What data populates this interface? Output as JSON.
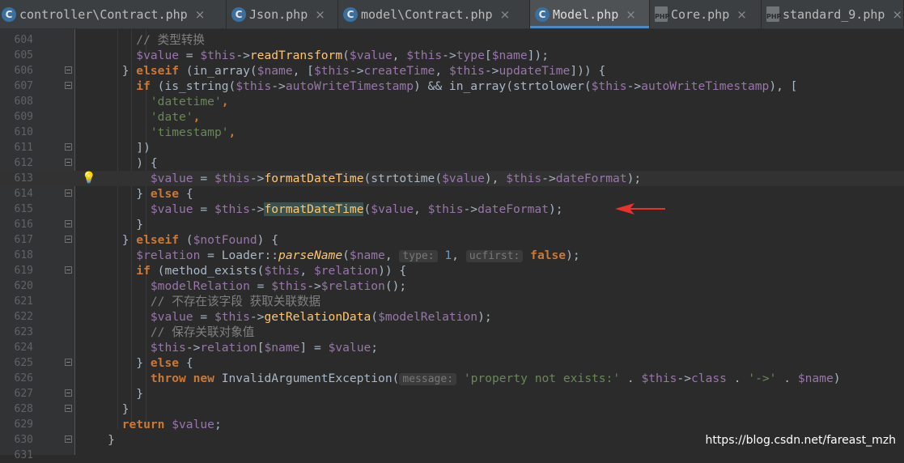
{
  "tabs": [
    {
      "label": "controller\\Contract.php",
      "icon": "C",
      "icon_type": "php-class-icon",
      "close": "×",
      "active": false
    },
    {
      "label": "Json.php",
      "icon": "C",
      "icon_type": "php-class-icon",
      "close": "×",
      "active": false
    },
    {
      "label": "model\\Contract.php",
      "icon": "C",
      "icon_type": "php-class-icon",
      "close": "×",
      "active": false
    },
    {
      "label": "Model.php",
      "icon": "C",
      "icon_type": "php-class-icon",
      "close": "×",
      "active": true
    },
    {
      "label": "Core.php",
      "icon": "PHP",
      "icon_type": "php-file-icon",
      "close": "×",
      "active": false
    },
    {
      "label": "standard_9.php",
      "icon": "PHP",
      "icon_type": "php-file-icon",
      "close": "×",
      "active": false
    }
  ],
  "lines": [
    {
      "num": "604",
      "fold": false,
      "indent": 8,
      "segs": [
        {
          "t": "// 类型转换",
          "c": "cmt"
        }
      ]
    },
    {
      "num": "605",
      "fold": false,
      "indent": 8,
      "segs": [
        {
          "t": "$value",
          "c": "var"
        },
        {
          "t": " = ",
          "c": "pl"
        },
        {
          "t": "$this",
          "c": "var"
        },
        {
          "t": "->",
          "c": "pl"
        },
        {
          "t": "readTransform",
          "c": "fn"
        },
        {
          "t": "(",
          "c": "pl"
        },
        {
          "t": "$value",
          "c": "var"
        },
        {
          "t": ", ",
          "c": "pl"
        },
        {
          "t": "$this",
          "c": "var"
        },
        {
          "t": "->",
          "c": "pl"
        },
        {
          "t": "type",
          "c": "var"
        },
        {
          "t": "[",
          "c": "pl"
        },
        {
          "t": "$name",
          "c": "var"
        },
        {
          "t": "]);",
          "c": "pl"
        }
      ]
    },
    {
      "num": "606",
      "fold": true,
      "indent": 6,
      "segs": [
        {
          "t": "} ",
          "c": "pl"
        },
        {
          "t": "elseif",
          "c": "kw"
        },
        {
          "t": " (in_array(",
          "c": "pl"
        },
        {
          "t": "$name",
          "c": "var"
        },
        {
          "t": ", [",
          "c": "pl"
        },
        {
          "t": "$this",
          "c": "var"
        },
        {
          "t": "->",
          "c": "pl"
        },
        {
          "t": "createTime",
          "c": "var"
        },
        {
          "t": ", ",
          "c": "pl"
        },
        {
          "t": "$this",
          "c": "var"
        },
        {
          "t": "->",
          "c": "pl"
        },
        {
          "t": "updateTime",
          "c": "var"
        },
        {
          "t": "])) {",
          "c": "pl"
        }
      ]
    },
    {
      "num": "607",
      "fold": true,
      "indent": 8,
      "segs": [
        {
          "t": "if",
          "c": "kw"
        },
        {
          "t": " (is_string(",
          "c": "pl"
        },
        {
          "t": "$this",
          "c": "var"
        },
        {
          "t": "->",
          "c": "pl"
        },
        {
          "t": "autoWriteTimestamp",
          "c": "var"
        },
        {
          "t": ") && in_array(strtolower(",
          "c": "pl"
        },
        {
          "t": "$this",
          "c": "var"
        },
        {
          "t": "->",
          "c": "pl"
        },
        {
          "t": "autoWriteTimestamp",
          "c": "var"
        },
        {
          "t": "), [",
          "c": "pl"
        }
      ]
    },
    {
      "num": "608",
      "fold": false,
      "indent": 10,
      "segs": [
        {
          "t": "'datetime'",
          "c": "str"
        },
        {
          "t": ",",
          "c": "kw"
        }
      ]
    },
    {
      "num": "609",
      "fold": false,
      "indent": 10,
      "segs": [
        {
          "t": "'date'",
          "c": "str"
        },
        {
          "t": ",",
          "c": "kw"
        }
      ]
    },
    {
      "num": "610",
      "fold": false,
      "indent": 10,
      "segs": [
        {
          "t": "'timestamp'",
          "c": "str"
        },
        {
          "t": ",",
          "c": "kw"
        }
      ]
    },
    {
      "num": "611",
      "fold": true,
      "indent": 8,
      "segs": [
        {
          "t": "])",
          "c": "pl"
        }
      ]
    },
    {
      "num": "612",
      "fold": true,
      "indent": 8,
      "segs": [
        {
          "t": ") {",
          "c": "pl"
        }
      ]
    },
    {
      "num": "613",
      "fold": false,
      "indent": 10,
      "hl": true,
      "bulb": true,
      "segs": [
        {
          "t": "$value",
          "c": "var"
        },
        {
          "t": " = ",
          "c": "pl"
        },
        {
          "t": "$this",
          "c": "var"
        },
        {
          "t": "->",
          "c": "pl"
        },
        {
          "t": "formatDateTime",
          "c": "fn"
        },
        {
          "t": "(strtotime(",
          "c": "pl"
        },
        {
          "t": "$value",
          "c": "var"
        },
        {
          "t": "), ",
          "c": "pl"
        },
        {
          "t": "$this",
          "c": "var"
        },
        {
          "t": "->",
          "c": "pl"
        },
        {
          "t": "dateFormat",
          "c": "var"
        },
        {
          "t": ");",
          "c": "pl"
        }
      ]
    },
    {
      "num": "614",
      "fold": true,
      "indent": 8,
      "segs": [
        {
          "t": "} ",
          "c": "pl"
        },
        {
          "t": "else",
          "c": "kw"
        },
        {
          "t": " {",
          "c": "pl"
        }
      ]
    },
    {
      "num": "615",
      "fold": false,
      "indent": 10,
      "segs": [
        {
          "t": "$value",
          "c": "var"
        },
        {
          "t": " = ",
          "c": "pl"
        },
        {
          "t": "$this",
          "c": "var"
        },
        {
          "t": "->",
          "c": "pl"
        },
        {
          "t": "formatDateTime",
          "c": "fmatch"
        },
        {
          "t": "(",
          "c": "pl"
        },
        {
          "t": "$value",
          "c": "var"
        },
        {
          "t": ", ",
          "c": "pl"
        },
        {
          "t": "$this",
          "c": "var"
        },
        {
          "t": "->",
          "c": "pl"
        },
        {
          "t": "dateFormat",
          "c": "var"
        },
        {
          "t": ");",
          "c": "pl"
        }
      ]
    },
    {
      "num": "616",
      "fold": true,
      "indent": 8,
      "segs": [
        {
          "t": "}",
          "c": "pl"
        }
      ]
    },
    {
      "num": "617",
      "fold": true,
      "indent": 6,
      "segs": [
        {
          "t": "} ",
          "c": "pl"
        },
        {
          "t": "elseif",
          "c": "kw"
        },
        {
          "t": " (",
          "c": "pl"
        },
        {
          "t": "$notFound",
          "c": "var"
        },
        {
          "t": ") {",
          "c": "pl"
        }
      ]
    },
    {
      "num": "618",
      "fold": false,
      "indent": 8,
      "segs": [
        {
          "t": "$relation",
          "c": "var"
        },
        {
          "t": " = Loader::",
          "c": "pl"
        },
        {
          "t": "parseName",
          "c": "it"
        },
        {
          "t": "(",
          "c": "pl"
        },
        {
          "t": "$name",
          "c": "var"
        },
        {
          "t": ", ",
          "c": "pl"
        },
        {
          "t": "type:",
          "c": "hint"
        },
        {
          "t": " ",
          "c": "pl"
        },
        {
          "t": "1",
          "c": "num"
        },
        {
          "t": ", ",
          "c": "pl"
        },
        {
          "t": "ucfirst:",
          "c": "hint"
        },
        {
          "t": " ",
          "c": "pl"
        },
        {
          "t": "false",
          "c": "kw"
        },
        {
          "t": ");",
          "c": "pl"
        }
      ]
    },
    {
      "num": "619",
      "fold": true,
      "indent": 8,
      "segs": [
        {
          "t": "if",
          "c": "kw"
        },
        {
          "t": " (method_exists(",
          "c": "pl"
        },
        {
          "t": "$this",
          "c": "var"
        },
        {
          "t": ", ",
          "c": "pl"
        },
        {
          "t": "$relation",
          "c": "var"
        },
        {
          "t": ")) {",
          "c": "pl"
        }
      ]
    },
    {
      "num": "620",
      "fold": false,
      "indent": 10,
      "segs": [
        {
          "t": "$modelRelation",
          "c": "var"
        },
        {
          "t": " = ",
          "c": "pl"
        },
        {
          "t": "$this",
          "c": "var"
        },
        {
          "t": "->",
          "c": "pl"
        },
        {
          "t": "$relation",
          "c": "var"
        },
        {
          "t": "();",
          "c": "pl"
        }
      ]
    },
    {
      "num": "621",
      "fold": false,
      "indent": 10,
      "segs": [
        {
          "t": "// 不存在该字段 获取关联数据",
          "c": "cmt"
        }
      ]
    },
    {
      "num": "622",
      "fold": false,
      "indent": 10,
      "segs": [
        {
          "t": "$value",
          "c": "var"
        },
        {
          "t": " = ",
          "c": "pl"
        },
        {
          "t": "$this",
          "c": "var"
        },
        {
          "t": "->",
          "c": "pl"
        },
        {
          "t": "getRelationData",
          "c": "fn"
        },
        {
          "t": "(",
          "c": "pl"
        },
        {
          "t": "$modelRelation",
          "c": "var"
        },
        {
          "t": ");",
          "c": "pl"
        }
      ]
    },
    {
      "num": "623",
      "fold": false,
      "indent": 10,
      "segs": [
        {
          "t": "// 保存关联对象值",
          "c": "cmt"
        }
      ]
    },
    {
      "num": "624",
      "fold": false,
      "indent": 10,
      "segs": [
        {
          "t": "$this",
          "c": "var"
        },
        {
          "t": "->",
          "c": "pl"
        },
        {
          "t": "relation",
          "c": "var"
        },
        {
          "t": "[",
          "c": "pl"
        },
        {
          "t": "$name",
          "c": "var"
        },
        {
          "t": "] = ",
          "c": "pl"
        },
        {
          "t": "$value",
          "c": "var"
        },
        {
          "t": ";",
          "c": "pl"
        }
      ]
    },
    {
      "num": "625",
      "fold": true,
      "indent": 8,
      "segs": [
        {
          "t": "} ",
          "c": "pl"
        },
        {
          "t": "else",
          "c": "kw"
        },
        {
          "t": " {",
          "c": "pl"
        }
      ]
    },
    {
      "num": "626",
      "fold": false,
      "indent": 10,
      "segs": [
        {
          "t": "throw new",
          "c": "kw"
        },
        {
          "t": " InvalidArgumentException(",
          "c": "pl"
        },
        {
          "t": "message:",
          "c": "hint"
        },
        {
          "t": " ",
          "c": "pl"
        },
        {
          "t": "'property not exists:'",
          "c": "str"
        },
        {
          "t": " . ",
          "c": "pl"
        },
        {
          "t": "$this",
          "c": "var"
        },
        {
          "t": "->",
          "c": "pl"
        },
        {
          "t": "class",
          "c": "var"
        },
        {
          "t": " . ",
          "c": "pl"
        },
        {
          "t": "'->'",
          "c": "str"
        },
        {
          "t": " . ",
          "c": "pl"
        },
        {
          "t": "$name",
          "c": "var"
        },
        {
          "t": ")",
          "c": "pl"
        }
      ]
    },
    {
      "num": "627",
      "fold": true,
      "indent": 8,
      "segs": [
        {
          "t": "}",
          "c": "pl"
        }
      ]
    },
    {
      "num": "628",
      "fold": true,
      "indent": 6,
      "segs": [
        {
          "t": "}",
          "c": "pl"
        }
      ]
    },
    {
      "num": "629",
      "fold": false,
      "indent": 6,
      "segs": [
        {
          "t": "return",
          "c": "kw"
        },
        {
          "t": " ",
          "c": "pl"
        },
        {
          "t": "$value",
          "c": "var"
        },
        {
          "t": ";",
          "c": "pl"
        }
      ]
    },
    {
      "num": "630",
      "fold": true,
      "indent": 4,
      "segs": [
        {
          "t": "}",
          "c": "pl"
        }
      ]
    },
    {
      "num": "631",
      "fold": false,
      "indent": 0,
      "segs": []
    }
  ],
  "watermark": "https://blog.csdn.net/fareast_mzh",
  "colors": {
    "keyword": "#cc7832",
    "variable": "#9876aa",
    "function": "#ffc66d",
    "string": "#6a8759",
    "number": "#6897bb",
    "comment": "#808080",
    "arrow": "#e8322b"
  }
}
